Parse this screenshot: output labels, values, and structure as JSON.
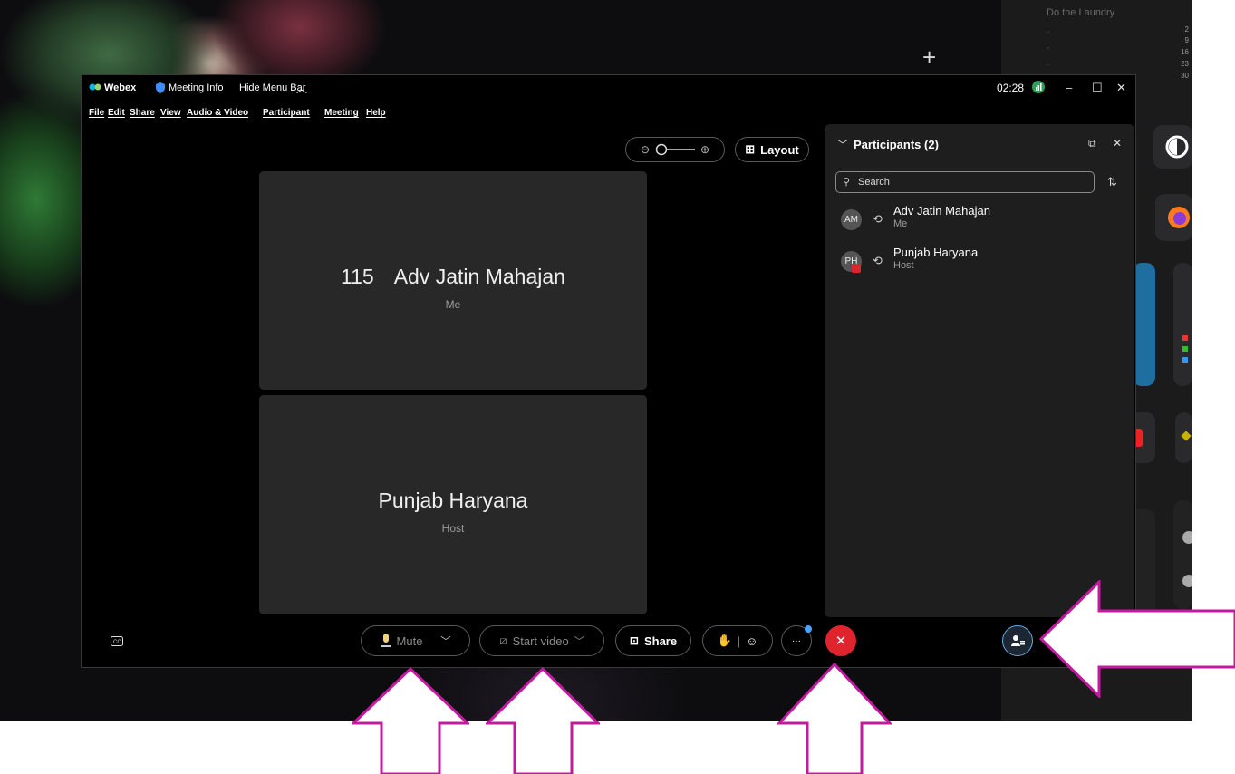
{
  "desktop": {
    "calendar_item": "Do the Laundry",
    "calendar_numbers": [
      "2",
      "9",
      "16",
      "23",
      "30"
    ],
    "plus_symbol": "+"
  },
  "titlebar": {
    "app_name": "Webex",
    "meeting_info": "Meeting Info",
    "hide_menu": "Hide Menu Bar",
    "time": "02:28"
  },
  "menu": [
    "File",
    "Edit",
    "Share",
    "View",
    "Audio & Video",
    "Participant",
    "Meeting",
    "Help"
  ],
  "toolbar_top": {
    "layout_label": "Layout"
  },
  "tiles": [
    {
      "number": "115",
      "name": "Adv Jatin Mahajan",
      "role": "Me"
    },
    {
      "name": "Punjab Haryana",
      "role": "Host"
    }
  ],
  "participants_panel": {
    "title": "Participants (2)",
    "search_placeholder": "Search",
    "participants": [
      {
        "initials": "AM",
        "name": "Adv Jatin Mahajan",
        "role": "Me"
      },
      {
        "initials": "PH",
        "name": "Punjab Haryana",
        "role": "Host"
      }
    ]
  },
  "bottom_bar": {
    "mute_label": "Mute",
    "video_label": "Start video",
    "share_label": "Share",
    "more_label": "···"
  },
  "colors": {
    "annotation_arrow": "#c41aa0",
    "end_call": "#e0242e",
    "tile_bg": "#282828",
    "panel_bg": "#1e1e1e"
  }
}
